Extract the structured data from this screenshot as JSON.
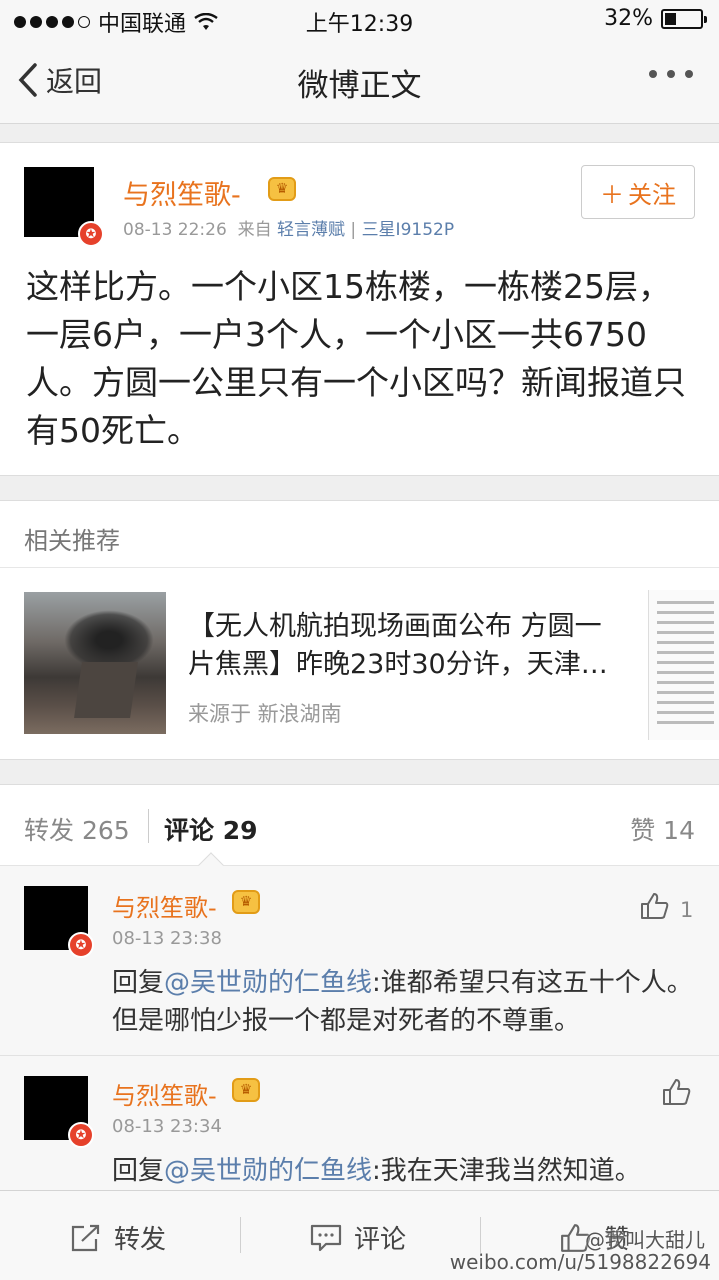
{
  "status_bar": {
    "carrier": "中国联通",
    "time": "上午12:39",
    "battery": "32%",
    "battery_level": 0.32
  },
  "nav": {
    "back_label": "返回",
    "title": "微博正文"
  },
  "post": {
    "username": "与烈笙歌-",
    "time": "08-13 22:26",
    "from_label": "来自",
    "source": "轻言薄赋",
    "separator": "|",
    "device": "三星I9152P",
    "follow_label": "关注",
    "text": "这样比方。一个小区15栋楼，一栋楼25层，一层6户，一户3个人，一个小区一共6750人。方圆一公里只有一个小区吗？新闻报道只有50死亡。"
  },
  "related": {
    "header": "相关推荐",
    "title": "【无人机航拍现场画面公布 方圆一片焦黑】昨晚23时30分许，天津…",
    "source": "来源于 新浪湖南"
  },
  "tabs": {
    "repost": "转发 265",
    "comment": "评论 29",
    "like": "赞 14"
  },
  "comments": [
    {
      "username": "与烈笙歌-",
      "time": "08-13 23:38",
      "reply_prefix": "回复",
      "mention": "@吴世勋的仁鱼线",
      "text": ":谁都希望只有这五十个人。但是哪怕少报一个都是对死者的不尊重。",
      "likes": "1"
    },
    {
      "username": "与烈笙歌-",
      "time": "08-13 23:34",
      "reply_prefix": "回复",
      "mention": "@吴世勋的仁鱼线",
      "text": ":我在天津我当然知道。",
      "likes": ""
    }
  ],
  "toolbar": {
    "repost": "转发",
    "comment": "评论",
    "like": "赞"
  },
  "watermark": {
    "user": "@我叫大甜儿",
    "url": "weibo.com/u/5198822694"
  },
  "colors": {
    "username": "#e8731e",
    "link": "#5b7eab",
    "verified": "#e6412b"
  },
  "icons": [
    "wifi-icon",
    "back-chevron-icon",
    "more-icon",
    "crown-icon",
    "verified-badge-icon",
    "plus-icon",
    "like-icon",
    "repost-icon",
    "comment-icon"
  ]
}
